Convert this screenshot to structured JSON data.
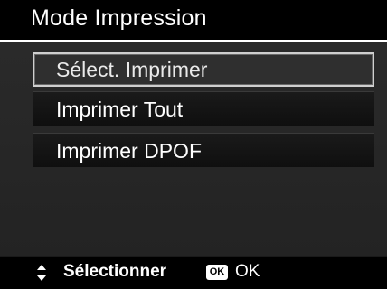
{
  "header": {
    "title": "Mode Impression"
  },
  "menu": {
    "items": [
      {
        "label": "Sélect. Imprimer",
        "selected": true
      },
      {
        "label": "Imprimer Tout",
        "selected": false
      },
      {
        "label": "Imprimer DPOF",
        "selected": false
      }
    ]
  },
  "footer": {
    "navigate_icon": "up-down-arrows-icon",
    "navigate_label": "Sélectionner",
    "ok_icon": "ok-button-icon",
    "ok_icon_text": "OK",
    "ok_label": "OK"
  }
}
